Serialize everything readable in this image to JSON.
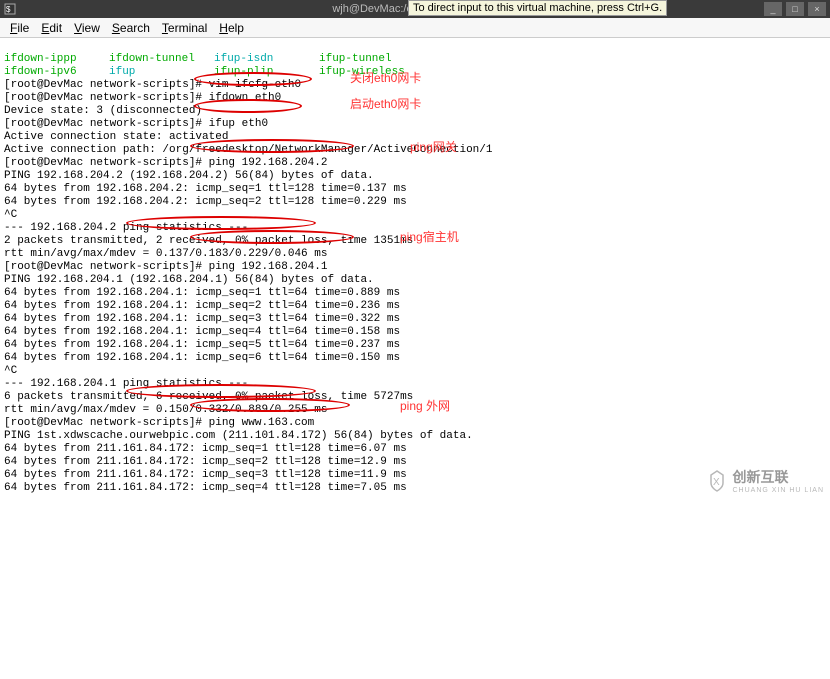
{
  "title_bar": {
    "title": "wjh@DevMac:/etc/syscc",
    "tooltip": "To direct input to this virtual machine, press Ctrl+G."
  },
  "menu": {
    "file": "File",
    "edit": "Edit",
    "view": "View",
    "search": "Search",
    "terminal": "Terminal",
    "help": "Help"
  },
  "term": {
    "cmd1": "ifdown-ippp",
    "cmd2": "ifdown-tunnel",
    "cmd3": "ifup-isdn",
    "cmd4": "ifup-tunnel",
    "cmd5": "ifdown-ipv6",
    "cmd6": "ifup",
    "cmd7": "ifup-plip",
    "cmd8": "ifup-wireless",
    "p1": "[root@DevMac network-scripts]# vim ifcfg-eth0",
    "p2": "[root@DevMac network-scripts]# ifdown eth0",
    "p3": "Device state: 3 (disconnected)",
    "p4": "[root@DevMac network-scripts]# ifup eth0",
    "p5": "Active connection state: activated",
    "p6": "Active connection path: /org/freedesktop/NetworkManager/ActiveConnection/1",
    "p7": "[root@DevMac network-scripts]# ping 192.168.204.2",
    "p8": "PING 192.168.204.2 (192.168.204.2) 56(84) bytes of data.",
    "p9": "64 bytes from 192.168.204.2: icmp_seq=1 ttl=128 time=0.137 ms",
    "p10": "64 bytes from 192.168.204.2: icmp_seq=2 ttl=128 time=0.229 ms",
    "p11": "^C",
    "p12": "--- 192.168.204.2 ping statistics ---",
    "p13": "2 packets transmitted, 2 received, 0% packet loss, time 1351ms",
    "p14": "rtt min/avg/max/mdev = 0.137/0.183/0.229/0.046 ms",
    "p15": "[root@DevMac network-scripts]# ping 192.168.204.1",
    "p16": "PING 192.168.204.1 (192.168.204.1) 56(84) bytes of data.",
    "p17": "64 bytes from 192.168.204.1: icmp_seq=1 ttl=64 time=0.889 ms",
    "p18": "64 bytes from 192.168.204.1: icmp_seq=2 ttl=64 time=0.236 ms",
    "p19": "64 bytes from 192.168.204.1: icmp_seq=3 ttl=64 time=0.322 ms",
    "p20": "64 bytes from 192.168.204.1: icmp_seq=4 ttl=64 time=0.158 ms",
    "p21": "64 bytes from 192.168.204.1: icmp_seq=5 ttl=64 time=0.237 ms",
    "p22": "64 bytes from 192.168.204.1: icmp_seq=6 ttl=64 time=0.150 ms",
    "p23": "^C",
    "p24": "--- 192.168.204.1 ping statistics ---",
    "p25": "6 packets transmitted, 6 received, 0% packet loss, time 5727ms",
    "p26": "rtt min/avg/max/mdev = 0.150/0.332/0.889/0.255 ms",
    "p27": "[root@DevMac network-scripts]# ping www.163.com",
    "p28": "PING 1st.xdwscache.ourwebpic.com (211.101.84.172) 56(84) bytes of data.",
    "p29": "64 bytes from 211.161.84.172: icmp_seq=1 ttl=128 time=6.07 ms",
    "p30": "64 bytes from 211.161.84.172: icmp_seq=2 ttl=128 time=12.9 ms",
    "p31": "64 bytes from 211.161.84.172: icmp_seq=3 ttl=128 time=11.9 ms",
    "p32": "64 bytes from 211.161.84.172: icmp_seq=4 ttl=128 time=7.05 ms"
  },
  "anno": {
    "a1": "关闭eth0网卡",
    "a2": "启动eth0网卡",
    "a3": "ping网关",
    "a4": "ping宿主机",
    "a5": "ping 外网"
  },
  "win_controls": {
    "min": "_",
    "max": "□",
    "close": "×"
  },
  "watermark": {
    "cn": "创新互联",
    "en": "CHUANG XIN HU LIAN"
  }
}
